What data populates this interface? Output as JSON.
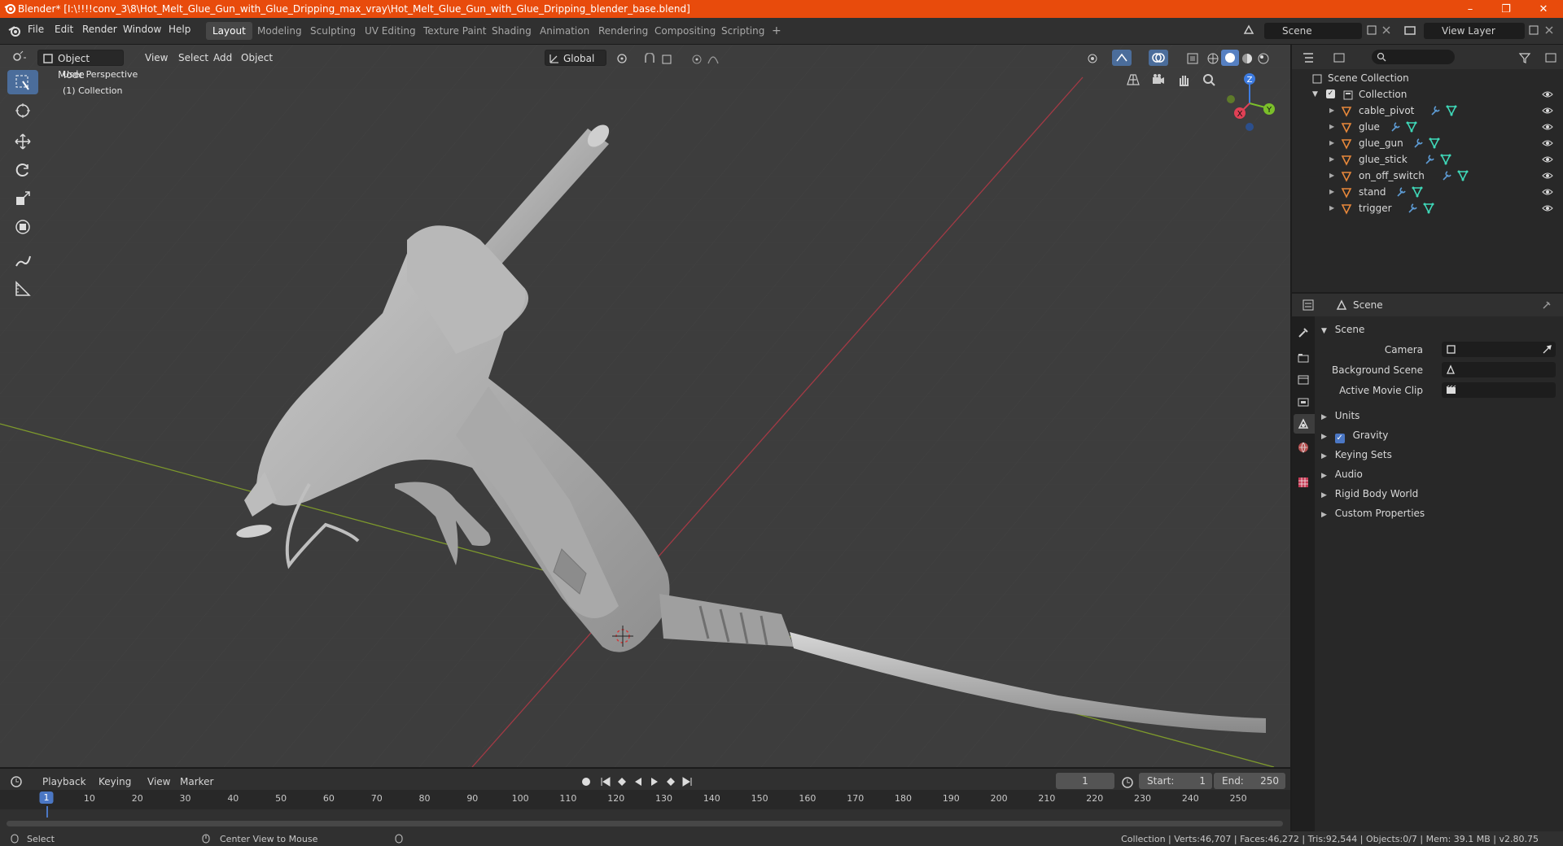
{
  "window": {
    "title": "Blender* [I:\\!!!!conv_3\\8\\Hot_Melt_Glue_Gun_with_Glue_Dripping_max_vray\\Hot_Melt_Glue_Gun_with_Glue_Dripping_blender_base.blend]",
    "controls": [
      "–",
      "❐",
      "✕"
    ]
  },
  "menu": [
    "File",
    "Edit",
    "Render",
    "Window",
    "Help"
  ],
  "workspaces": [
    "Layout",
    "Modeling",
    "Sculpting",
    "UV Editing",
    "Texture Paint",
    "Shading",
    "Animation",
    "Rendering",
    "Compositing",
    "Scripting",
    "+"
  ],
  "scene_selector": {
    "value": "Scene"
  },
  "viewlayer_selector": {
    "value": "View Layer"
  },
  "viewport_header": {
    "mode": "Object Mode",
    "menus": [
      "View",
      "Select",
      "Add",
      "Object"
    ],
    "orientation": "Global"
  },
  "viewport": {
    "perspective_label": "User Perspective",
    "collection_label": "(1) Collection",
    "gizmo_axes": {
      "z": "Z",
      "y": "Y",
      "x": "X"
    }
  },
  "outliner": {
    "root": "Scene Collection",
    "collection": "Collection",
    "objects": [
      "cable_pivot",
      "glue",
      "glue_gun",
      "glue_stick",
      "on_off_switch",
      "stand",
      "trigger"
    ]
  },
  "properties": {
    "header": "Scene",
    "section": "Scene",
    "fields": [
      {
        "label": "Camera",
        "value": ""
      },
      {
        "label": "Background Scene",
        "value": ""
      },
      {
        "label": "Active Movie Clip",
        "value": ""
      }
    ],
    "panels": [
      "Units",
      "Gravity",
      "Keying Sets",
      "Audio",
      "Rigid Body World",
      "Custom Properties"
    ],
    "gravity_checked": true
  },
  "timeline": {
    "menus": [
      "Playback",
      "Keying",
      "View",
      "Marker"
    ],
    "current_frame": "1",
    "start_label": "Start:",
    "start": "1",
    "end_label": "End:",
    "end": "250",
    "ticks": [
      "1",
      "10",
      "20",
      "30",
      "40",
      "50",
      "60",
      "70",
      "80",
      "90",
      "100",
      "110",
      "120",
      "130",
      "140",
      "150",
      "160",
      "170",
      "180",
      "190",
      "200",
      "210",
      "220",
      "230",
      "240",
      "250"
    ]
  },
  "statusbar": {
    "left": "Select",
    "middle": "Center View to Mouse",
    "right": "Collection | Verts:46,707 | Faces:46,272 | Tris:92,544 | Objects:0/7 | Mem: 39.1 MB | v2.80.75"
  },
  "colors": {
    "titlebar": "#e84b0c",
    "accent": "#4b6d9b",
    "object_icon": "#e8883a",
    "modifier_icon": "#5d9bd4",
    "mesh_icon": "#3fd8b8"
  }
}
